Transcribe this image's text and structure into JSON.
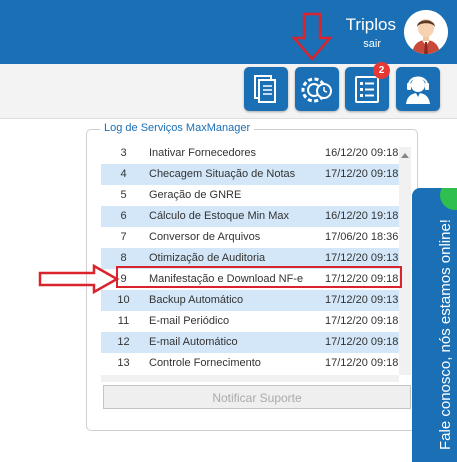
{
  "header": {
    "user_name": "Triplos",
    "logout_label": "sair"
  },
  "toolbar": {
    "buttons": [
      {
        "icon": "documents-icon"
      },
      {
        "icon": "gear-clock-icon"
      },
      {
        "icon": "checklist-icon",
        "badge": "2"
      },
      {
        "icon": "support-agent-icon"
      }
    ]
  },
  "log_panel": {
    "title": "Log de Serviços MaxManager",
    "rows": [
      {
        "num": "3",
        "service": "Inativar Fornecedores",
        "date": "16/12/20 09:18"
      },
      {
        "num": "4",
        "service": "Checagem Situação de Notas",
        "date": "17/12/20 09:18"
      },
      {
        "num": "5",
        "service": "Geração de GNRE",
        "date": ""
      },
      {
        "num": "6",
        "service": "Cálculo de Estoque Min Max",
        "date": "16/12/20 19:18"
      },
      {
        "num": "7",
        "service": "Conversor de Arquivos",
        "date": "17/06/20 18:36"
      },
      {
        "num": "8",
        "service": "Otimização de Auditoria",
        "date": "17/12/20 09:13"
      },
      {
        "num": "9",
        "service": "Manifestação e Download NF-e",
        "date": "17/12/20 09:18"
      },
      {
        "num": "10",
        "service": "Backup Automático",
        "date": "17/12/20 09:13"
      },
      {
        "num": "11",
        "service": "E-mail Periódico",
        "date": "17/12/20 09:18"
      },
      {
        "num": "12",
        "service": "E-mail Automático",
        "date": "17/12/20 09:18"
      },
      {
        "num": "13",
        "service": "Controle Fornecimento",
        "date": "17/12/20 09:18"
      }
    ],
    "support_button": "Notificar Suporte"
  },
  "chat_widget": {
    "label": "Fale conosco, nós estamos online!"
  },
  "colors": {
    "primary": "#1a6fb5",
    "row_alt": "#d3e7f8",
    "highlight": "#d9232d",
    "online": "#2ebf4f"
  }
}
